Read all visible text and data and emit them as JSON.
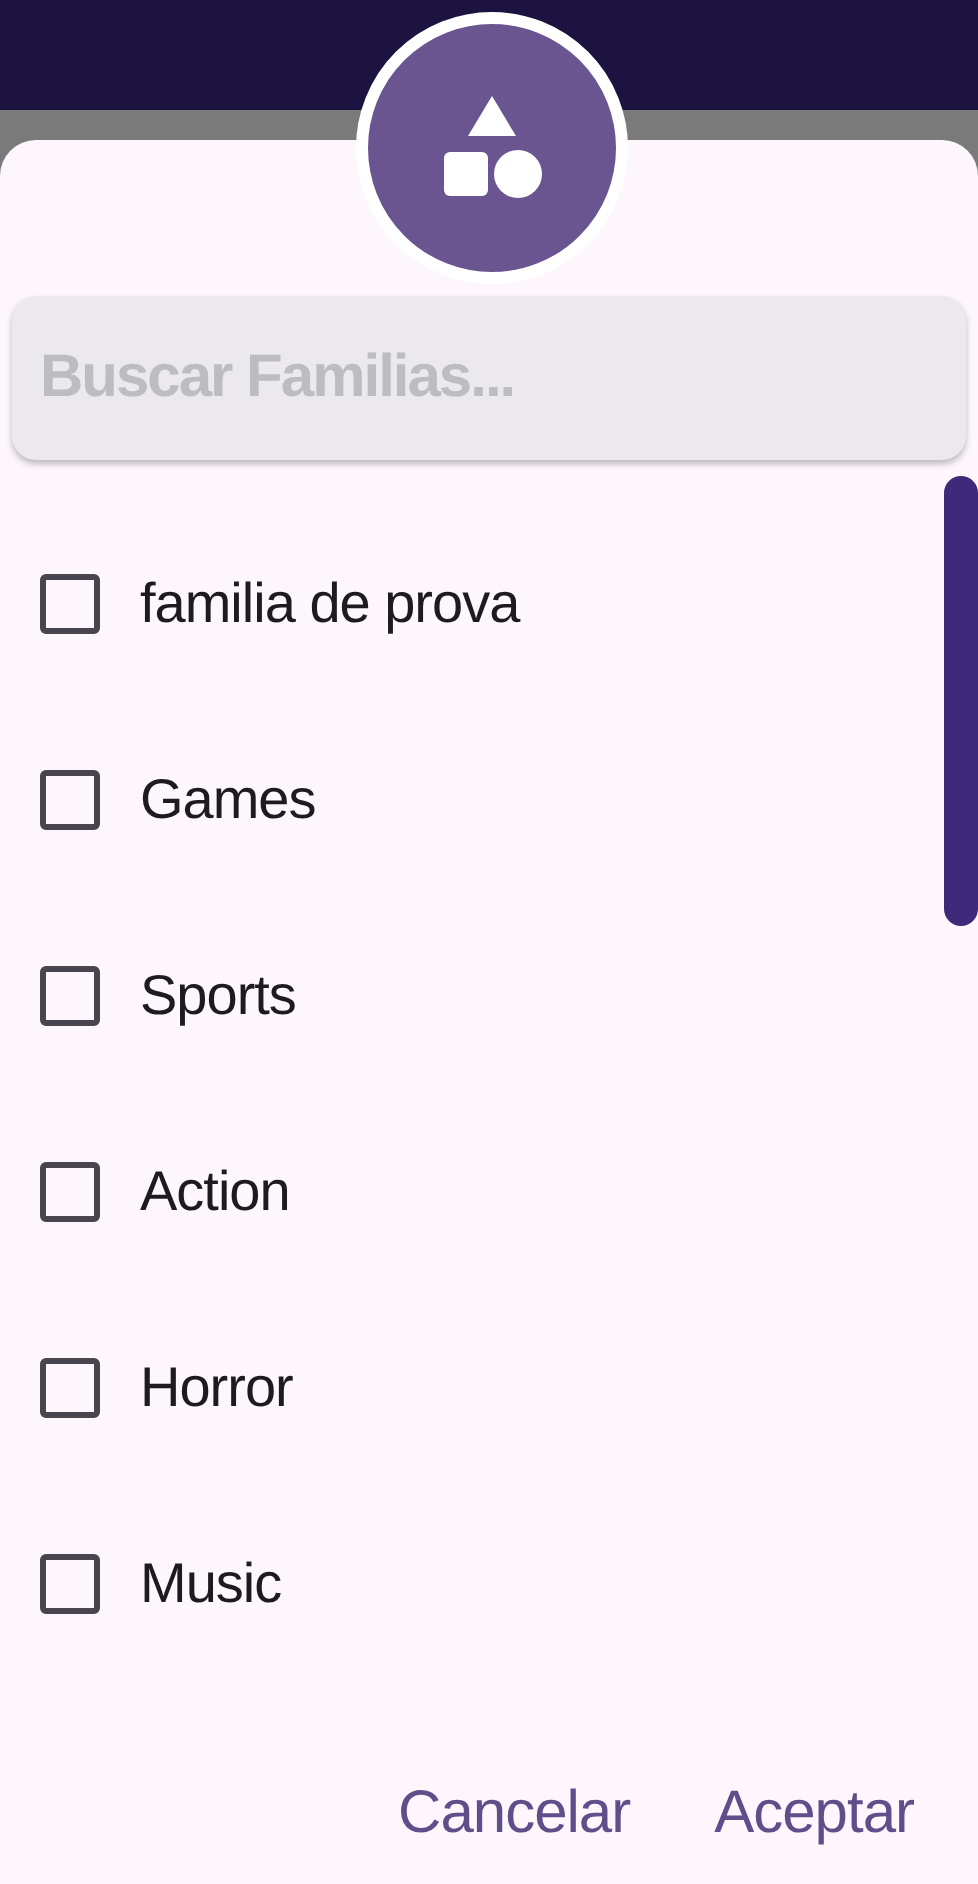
{
  "search": {
    "placeholder": "Buscar Familias..."
  },
  "items": [
    {
      "label": "familia de prova",
      "checked": false
    },
    {
      "label": "Games",
      "checked": false
    },
    {
      "label": "Sports",
      "checked": false
    },
    {
      "label": "Action",
      "checked": false
    },
    {
      "label": "Horror",
      "checked": false
    },
    {
      "label": "Music",
      "checked": false
    }
  ],
  "buttons": [
    "Cancelar",
    "Aceptar"
  ]
}
